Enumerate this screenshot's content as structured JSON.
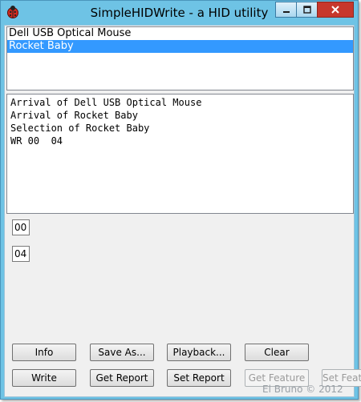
{
  "window": {
    "title": "SimpleHIDWrite - a HID utility",
    "icon": "ladybug-icon"
  },
  "devices": [
    "Dell USB Optical Mouse",
    "Rocket Baby"
  ],
  "selected_device": "Rocket Baby",
  "log_lines": [
    "Arrival of Dell USB Optical Mouse",
    "Arrival of Rocket Baby",
    "Selection of Rocket Baby",
    "WR 00  04"
  ],
  "fields": {
    "byte0": "00",
    "byte1": "04"
  },
  "buttons": {
    "info": "Info",
    "save_as": "Save As...",
    "playback": "Playback...",
    "clear": "Clear",
    "write": "Write",
    "get_report": "Get Report",
    "set_report": "Set Report",
    "get_feature": "Get Feature",
    "set_feature": "Set Feature"
  },
  "watermark": "El Bruno © 2012",
  "colors": {
    "frame": "#6ec3e5",
    "close": "#c7372c",
    "selection": "#3399ff"
  }
}
